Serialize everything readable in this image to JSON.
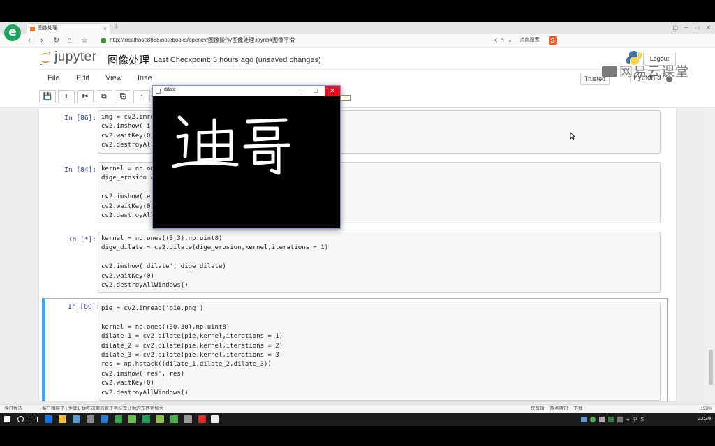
{
  "browser": {
    "tab_title": "图像处理",
    "tab_close": "×",
    "new_tab": "+",
    "url": "http://localhost:8888/notebooks/opencv/图像操作/图像处理.ipynb#图像平滑",
    "search_label": "点此搜索",
    "window_controls": [
      "▢",
      "─",
      "▭",
      "✕"
    ]
  },
  "jupyter": {
    "app_name": "jupyter",
    "notebook_title": "图像处理",
    "checkpoint": "Last Checkpoint: 5 hours ago (unsaved changes)",
    "logout": "Logout",
    "menu": [
      "File",
      "Edit",
      "View",
      "Inse"
    ],
    "trusted": "Trusted",
    "kernel": "Python 3",
    "toolbar": [
      "💾",
      "+",
      "✂",
      "⧉",
      "⎘",
      "↑"
    ]
  },
  "cells": [
    {
      "prompt": "In [86]:",
      "lines": [
        "img = cv2.imre",
        "cv2.imshow('i",
        "cv2.waitKey(0)",
        "cv2.destroyAll"
      ]
    },
    {
      "prompt": "In [84]:",
      "lines": [
        "kernel = np.on",
        "dige_erosion =",
        "",
        "cv2.imshow('e",
        "cv2.waitKey(0)",
        "cv2.destroyAllWindows()"
      ]
    },
    {
      "prompt": "In [*]:",
      "lines": [
        "kernel = np.ones((3,3),np.uint8)",
        "dige_dilate = cv2.dilate(dige_erosion,kernel,iterations = 1)",
        "",
        "cv2.imshow('dilate', dige_dilate)",
        "cv2.waitKey(0)",
        "cv2.destroyAllWindows()"
      ]
    },
    {
      "prompt": "In [80]:",
      "lines": [
        "pie = cv2.imread('pie.png')",
        "",
        "kernel = np.ones((30,30),np.uint8)",
        "dilate_1 = cv2.dilate(pie,kernel,iterations = 1)",
        "dilate_2 = cv2.dilate(pie,kernel,iterations = 2)",
        "dilate_3 = cv2.dilate(pie,kernel,iterations = 3)",
        "res = np.hstack((dilate_1,dilate_2,dilate_3))",
        "cv2.imshow('res', res)",
        "cv2.waitKey(0)",
        "cv2.destroyAllWindows()"
      ]
    }
  ],
  "cv_window": {
    "title": "dilate",
    "minimize": "─",
    "maximize": "□",
    "close": "✕",
    "image_text": "迪哥"
  },
  "statusbar": {
    "left": "今日优选",
    "news": "每日精粹子 | 生涯让你吃这辈的真正目标是让你的东西更加大",
    "right": [
      "快剪辑",
      "热点资讯",
      "下载"
    ],
    "zoom": "150%"
  },
  "taskbar": {
    "clock": "22:39",
    "tray": [
      "中",
      "S"
    ]
  },
  "watermark": "网易云课堂",
  "colors": {
    "accent_selected": "#42a5f5",
    "close_red": "#e81123",
    "prompt_blue": "#303f9f",
    "browser_green": "#1aa55f"
  }
}
